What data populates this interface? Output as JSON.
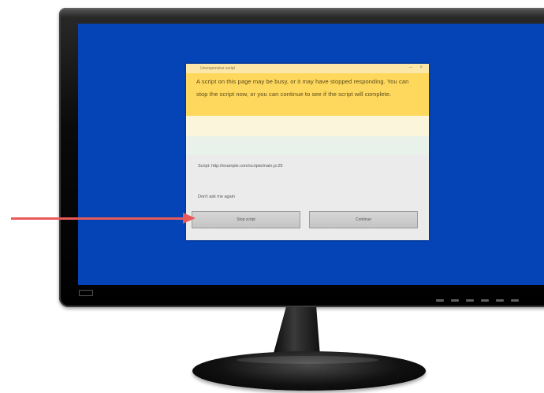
{
  "dialog": {
    "title": "Unresponsive script",
    "window_controls": [
      "–",
      "×"
    ],
    "message": "A script on this page may be busy, or it may have stopped responding. You can stop the script now, or you can continue to see if the script will complete.",
    "body_lines": [
      "Script: http://example.com/scripts/main.js:25",
      "Don't ask me again"
    ],
    "buttons": {
      "stop": "Stop script",
      "continue": "Continue"
    }
  },
  "colors": {
    "screen": "#0544b7",
    "header": "#fdd85d",
    "arrow": "#e85a5a"
  }
}
